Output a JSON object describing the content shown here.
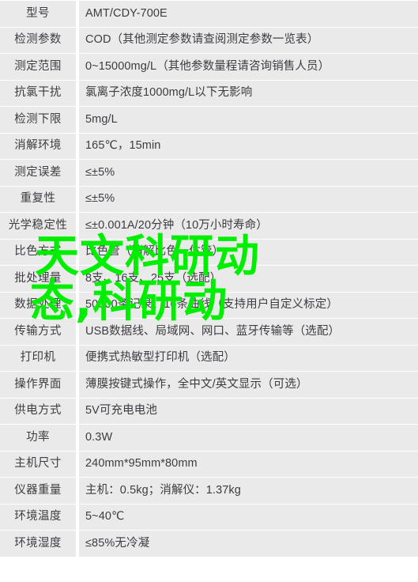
{
  "table": {
    "rows": [
      {
        "label": "型号",
        "value": "AMT/CDY-700E"
      },
      {
        "label": "检测参数",
        "value": "COD（其他测定参数请查阅测定参数一览表）"
      },
      {
        "label": "测定范围",
        "value": "0~15000mg/L（其他参数量程请咨询销售人员）"
      },
      {
        "label": "抗氯干扰",
        "value": "氯离子浓度1000mg/L以下无影响"
      },
      {
        "label": "检测下限",
        "value": "5mg/L"
      },
      {
        "label": "消解环境",
        "value": "165℃，15min"
      },
      {
        "label": "测定误差",
        "value": "≤±5%"
      },
      {
        "label": "重复性",
        "value": "≤±5%"
      },
      {
        "label": "光学稳定性",
        "value": "≤±0.001A/20分钟（10万小时寿命）"
      },
      {
        "label": "比色方式",
        "value": "比色管（消解比色一体管）"
      },
      {
        "label": "批处理量",
        "value": "8支、16支、25支（选配）"
      },
      {
        "label": "数据处理",
        "value": "50000条记录、16条曲线（支持用户自定义标定）"
      },
      {
        "label": "传输方式",
        "value": "USB数据线、局域网、网口、蓝牙传输等（选配）"
      },
      {
        "label": "打印机",
        "value": "便携式热敏型打印机（选配）"
      },
      {
        "label": "操作界面",
        "value": "薄膜按键式操作，全中文/英文显示（可选）"
      },
      {
        "label": "供电方式",
        "value": "5V可充电电池"
      },
      {
        "label": "功率",
        "value": "0.3W"
      },
      {
        "label": "主机尺寸",
        "value": "240mm*95mm*80mm"
      },
      {
        "label": "仪器重量",
        "value": "主机：0.5kg；消解仪：1.37kg"
      },
      {
        "label": "环境温度",
        "value": "5~40℃"
      },
      {
        "label": "环境湿度",
        "value": "≤85%无冷凝"
      }
    ]
  },
  "watermark": {
    "line1": "天文科研动",
    "line2": "态,科研动",
    "color": "#00ee00"
  },
  "colors": {
    "row_background": "#eaeaea",
    "page_background": "#ffffff",
    "text": "#3c3c42",
    "watermark": "#00ee00"
  }
}
